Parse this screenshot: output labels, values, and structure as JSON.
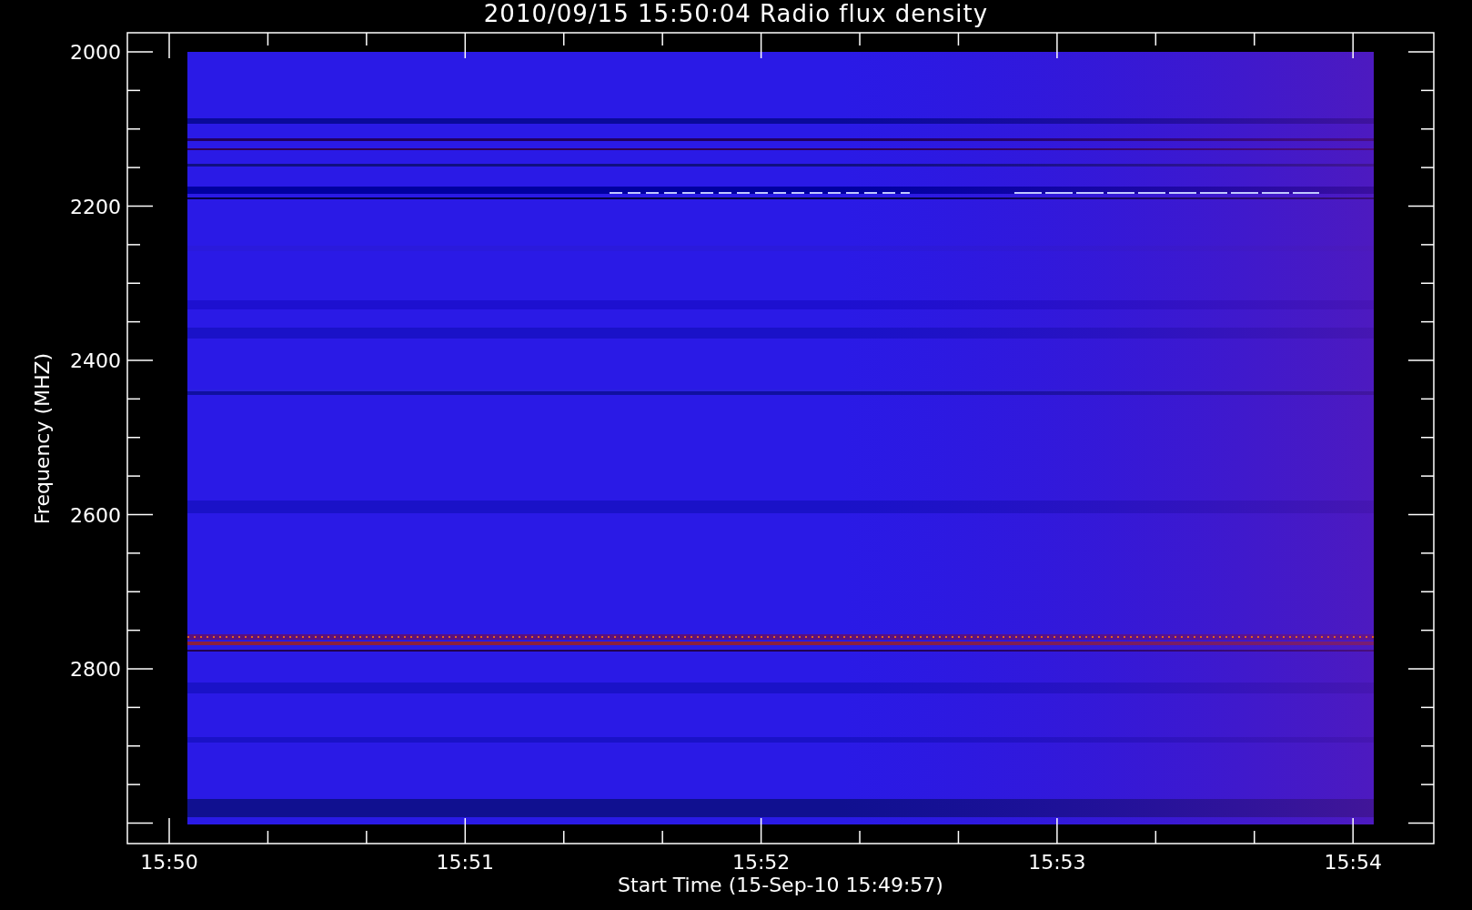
{
  "title": "2010/09/15 15:50:04 Radio flux density",
  "y_axis": {
    "label": "Frequency (MHZ)",
    "ticks": [
      "2000",
      "2200",
      "2400",
      "2600",
      "2800"
    ]
  },
  "x_axis": {
    "label": "Start Time (15-Sep-10 15:49:57)",
    "ticks": [
      "15:50",
      "15:51",
      "15:52",
      "15:53",
      "15:54"
    ]
  }
}
